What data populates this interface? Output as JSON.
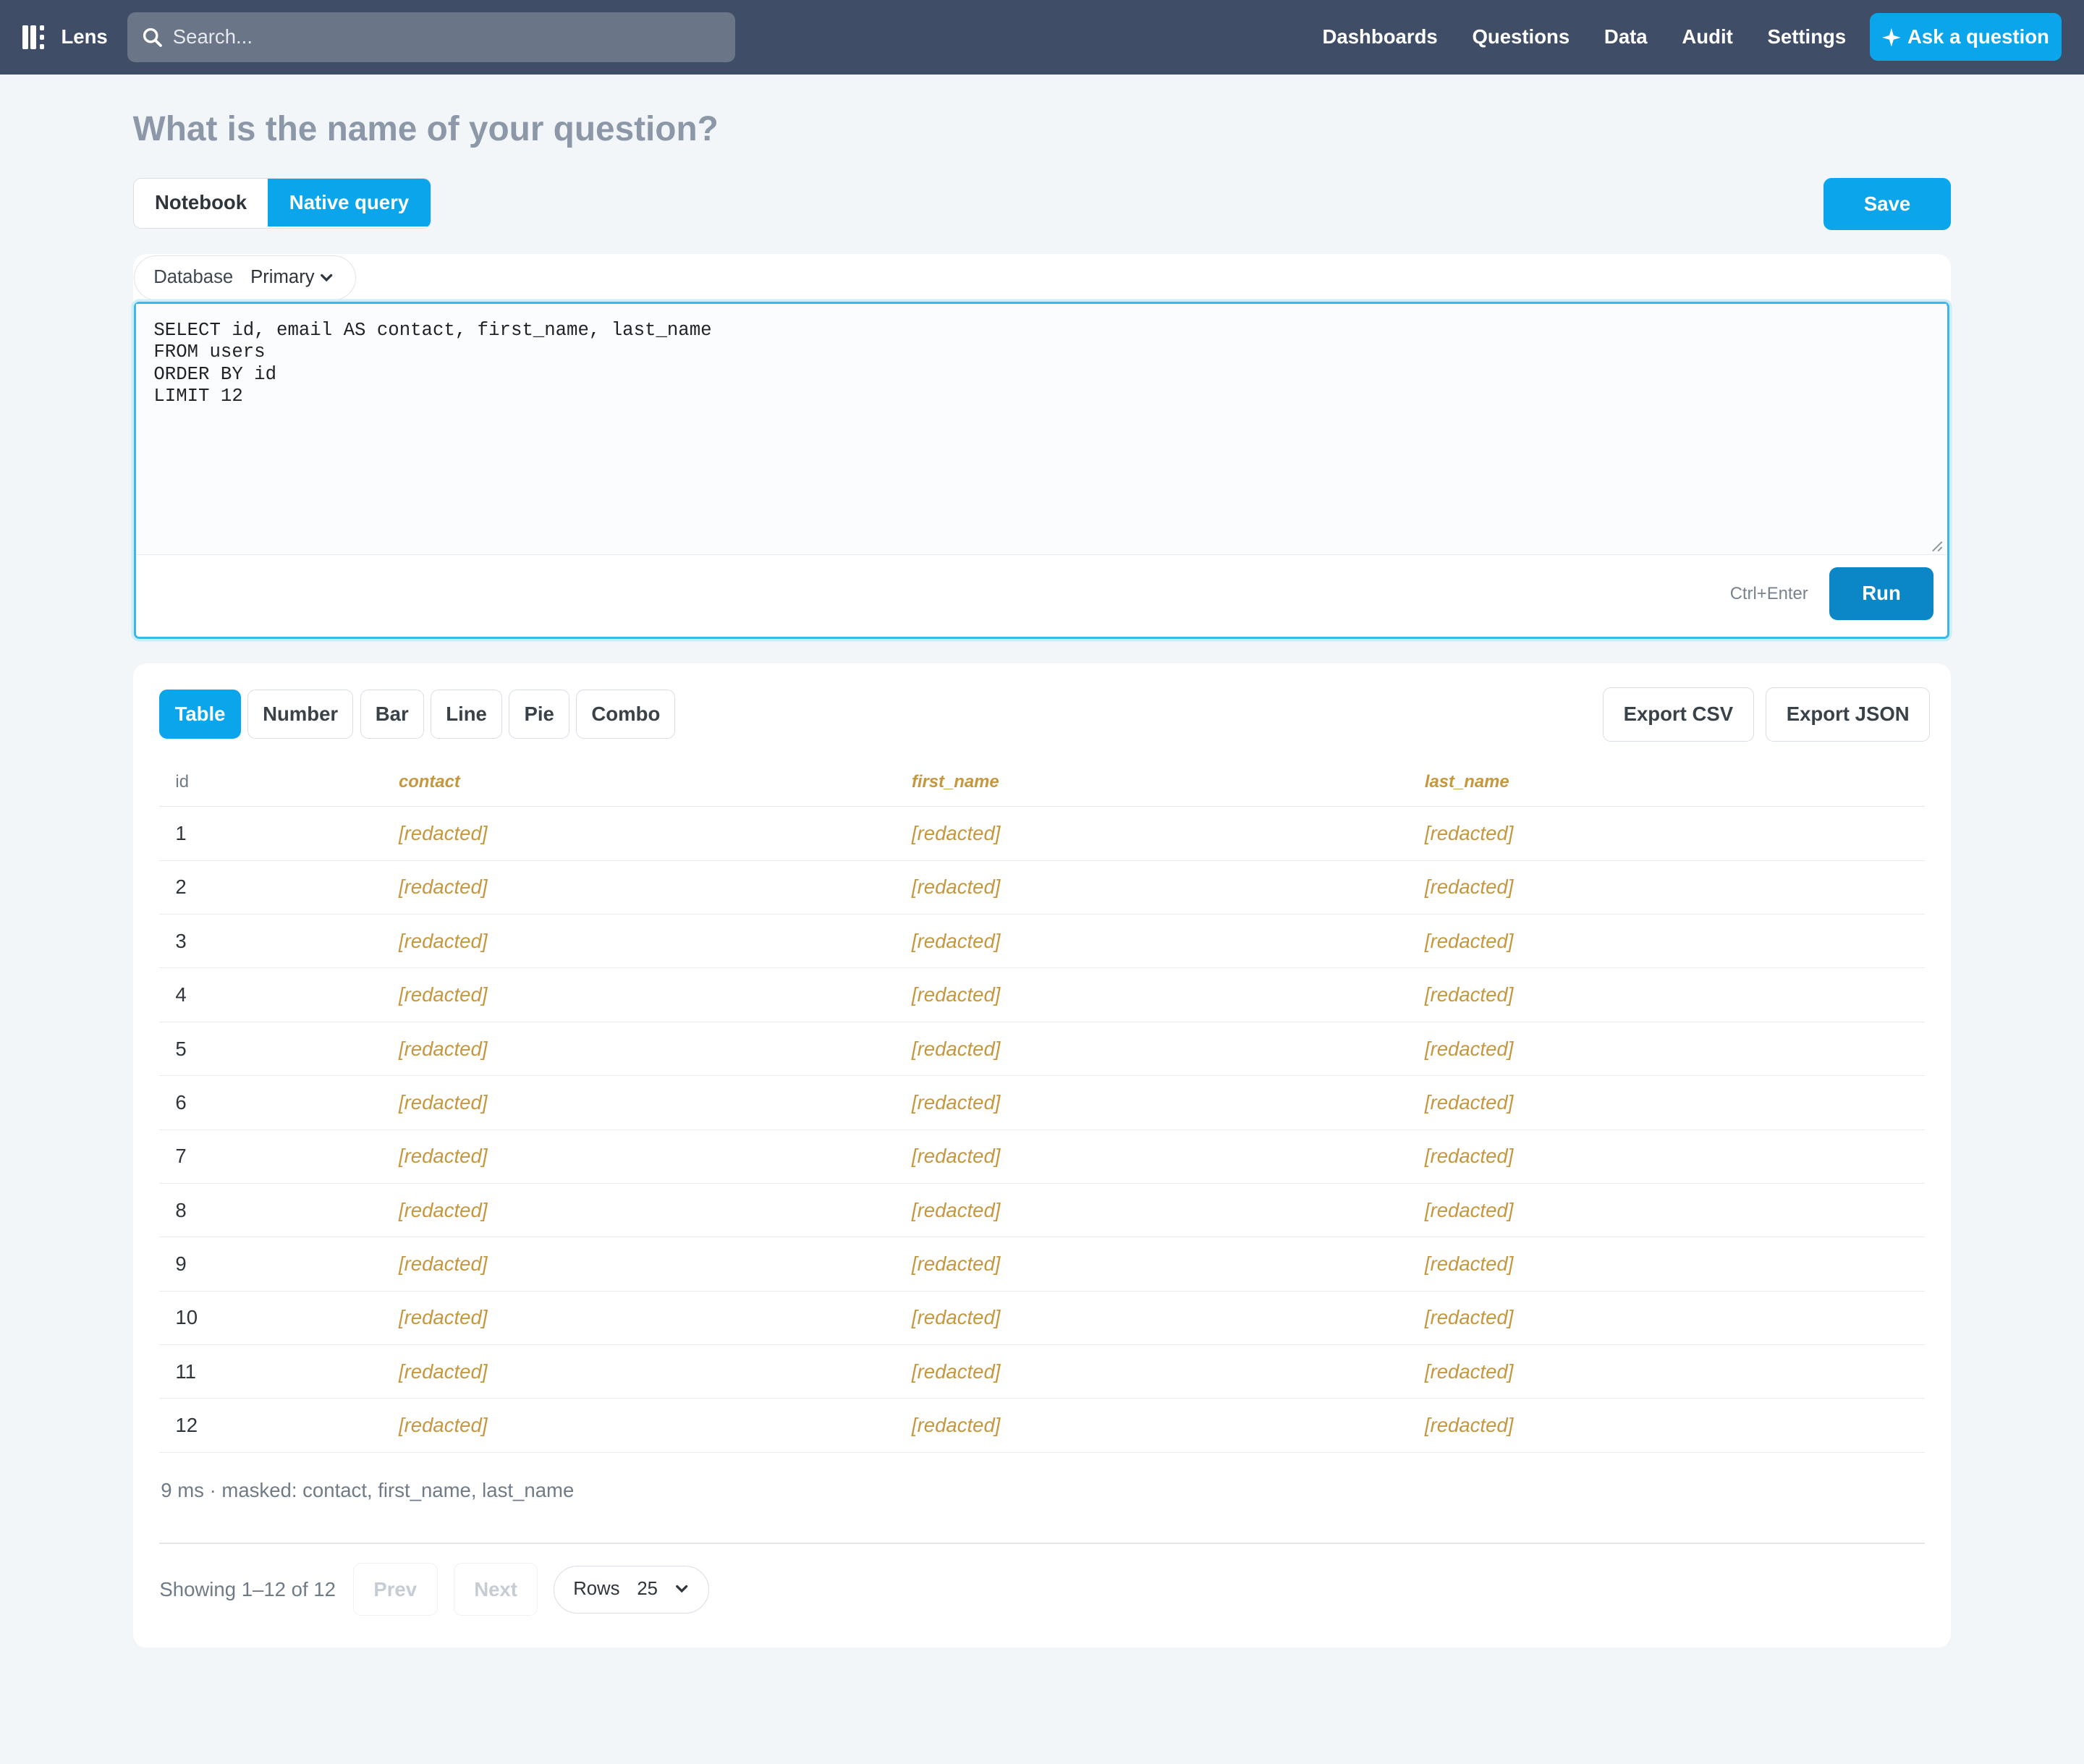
{
  "app": {
    "name": "Lens"
  },
  "search": {
    "placeholder": "Search..."
  },
  "nav": [
    "Dashboards",
    "Questions",
    "Data",
    "Audit",
    "Settings"
  ],
  "ask_button": "Ask a question",
  "question": {
    "title_placeholder": "What is the name of your question?"
  },
  "mode": {
    "options": [
      "Notebook",
      "Native query"
    ],
    "selected": "Native query"
  },
  "save_label": "Save",
  "database": {
    "label": "Database",
    "value": "Primary"
  },
  "sql": "SELECT id, email AS contact, first_name, last_name\nFROM users\nORDER BY id\nLIMIT 12",
  "run": {
    "hint": "Ctrl+Enter",
    "label": "Run"
  },
  "viz_tabs": [
    "Table",
    "Number",
    "Bar",
    "Line",
    "Pie",
    "Combo"
  ],
  "viz_selected": "Table",
  "export": {
    "csv": "Export CSV",
    "json": "Export JSON"
  },
  "table": {
    "columns": [
      {
        "name": "id",
        "masked": false
      },
      {
        "name": "contact",
        "masked": true
      },
      {
        "name": "first_name",
        "masked": true
      },
      {
        "name": "last_name",
        "masked": true
      }
    ],
    "rows": [
      [
        "1",
        "[redacted]",
        "[redacted]",
        "[redacted]"
      ],
      [
        "2",
        "[redacted]",
        "[redacted]",
        "[redacted]"
      ],
      [
        "3",
        "[redacted]",
        "[redacted]",
        "[redacted]"
      ],
      [
        "4",
        "[redacted]",
        "[redacted]",
        "[redacted]"
      ],
      [
        "5",
        "[redacted]",
        "[redacted]",
        "[redacted]"
      ],
      [
        "6",
        "[redacted]",
        "[redacted]",
        "[redacted]"
      ],
      [
        "7",
        "[redacted]",
        "[redacted]",
        "[redacted]"
      ],
      [
        "8",
        "[redacted]",
        "[redacted]",
        "[redacted]"
      ],
      [
        "9",
        "[redacted]",
        "[redacted]",
        "[redacted]"
      ],
      [
        "10",
        "[redacted]",
        "[redacted]",
        "[redacted]"
      ],
      [
        "11",
        "[redacted]",
        "[redacted]",
        "[redacted]"
      ],
      [
        "12",
        "[redacted]",
        "[redacted]",
        "[redacted]"
      ]
    ]
  },
  "meta": "9 ms · masked: contact, first_name, last_name",
  "pager": {
    "showing": "Showing 1–12 of 12",
    "prev": "Prev",
    "next": "Next",
    "rows_label": "Rows",
    "rows_value": "25"
  },
  "colors": {
    "nav_bg": "#3f4d66",
    "accent": "#0ba5ec",
    "run": "#0b87c7",
    "masked_text": "#c5973f"
  },
  "icons": {
    "logo": "lens-logo-icon",
    "search": "search-icon",
    "ask": "sparkle-icon",
    "db_chevron": "chevron-down-icon",
    "rows_chevron": "chevron-down-icon"
  }
}
